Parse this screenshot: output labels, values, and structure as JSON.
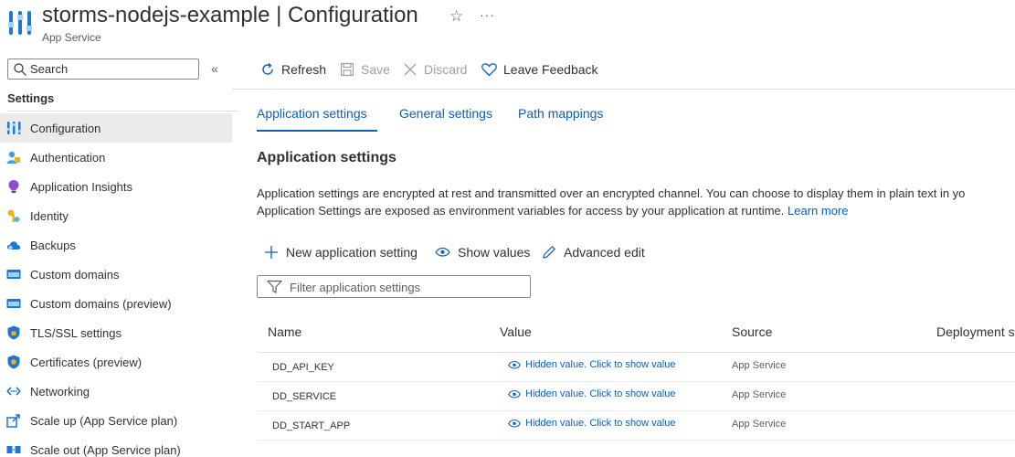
{
  "header": {
    "resource_name": "storms-nodejs-example",
    "separator": "|",
    "blade_name": "Configuration",
    "subtitle": "App Service",
    "favorite_glyph": "☆",
    "more_glyph": "···"
  },
  "sidebar": {
    "search_placeholder": "Search",
    "collapse_glyph": "«",
    "section_title": "Settings",
    "items": [
      {
        "label": "Configuration",
        "icon": "configuration-icon",
        "active": true
      },
      {
        "label": "Authentication",
        "icon": "authentication-icon"
      },
      {
        "label": "Application Insights",
        "icon": "application-insights-icon"
      },
      {
        "label": "Identity",
        "icon": "identity-icon"
      },
      {
        "label": "Backups",
        "icon": "backups-icon"
      },
      {
        "label": "Custom domains",
        "icon": "custom-domains-icon"
      },
      {
        "label": "Custom domains (preview)",
        "icon": "custom-domains-preview-icon"
      },
      {
        "label": "TLS/SSL settings",
        "icon": "tls-ssl-icon"
      },
      {
        "label": "Certificates (preview)",
        "icon": "certificates-icon"
      },
      {
        "label": "Networking",
        "icon": "networking-icon"
      },
      {
        "label": "Scale up (App Service plan)",
        "icon": "scale-up-icon"
      },
      {
        "label": "Scale out (App Service plan)",
        "icon": "scale-out-icon"
      }
    ]
  },
  "toolbar": {
    "refresh": "Refresh",
    "save": "Save",
    "discard": "Discard",
    "feedback": "Leave Feedback"
  },
  "tabs": {
    "app_settings": "Application settings",
    "general_settings": "General settings",
    "path_mappings": "Path mappings"
  },
  "content": {
    "heading": "Application settings",
    "description_line1": "Application settings are encrypted at rest and transmitted over an encrypted channel. You can choose to display them in plain text in yo",
    "description_line2": "Application Settings are exposed as environment variables for access by your application at runtime.",
    "learn_more": "Learn more",
    "new_setting": "New application setting",
    "show_values": "Show values",
    "advanced_edit": "Advanced edit",
    "filter_placeholder": "Filter application settings"
  },
  "table": {
    "columns": {
      "name": "Name",
      "value": "Value",
      "source": "Source",
      "deployment": "Deployment s"
    },
    "rows": [
      {
        "name": "DD_API_KEY",
        "value": "Hidden value. Click to show value",
        "source": "App Service"
      },
      {
        "name": "DD_SERVICE",
        "value": "Hidden value. Click to show value",
        "source": "App Service"
      },
      {
        "name": "DD_START_APP",
        "value": "Hidden value. Click to show value",
        "source": "App Service"
      }
    ]
  },
  "colors": {
    "accent": "#0f5fb0",
    "text": "#323130",
    "muted": "#605e5c",
    "disabled": "#a19f9d",
    "active_bg": "#edebe9"
  }
}
